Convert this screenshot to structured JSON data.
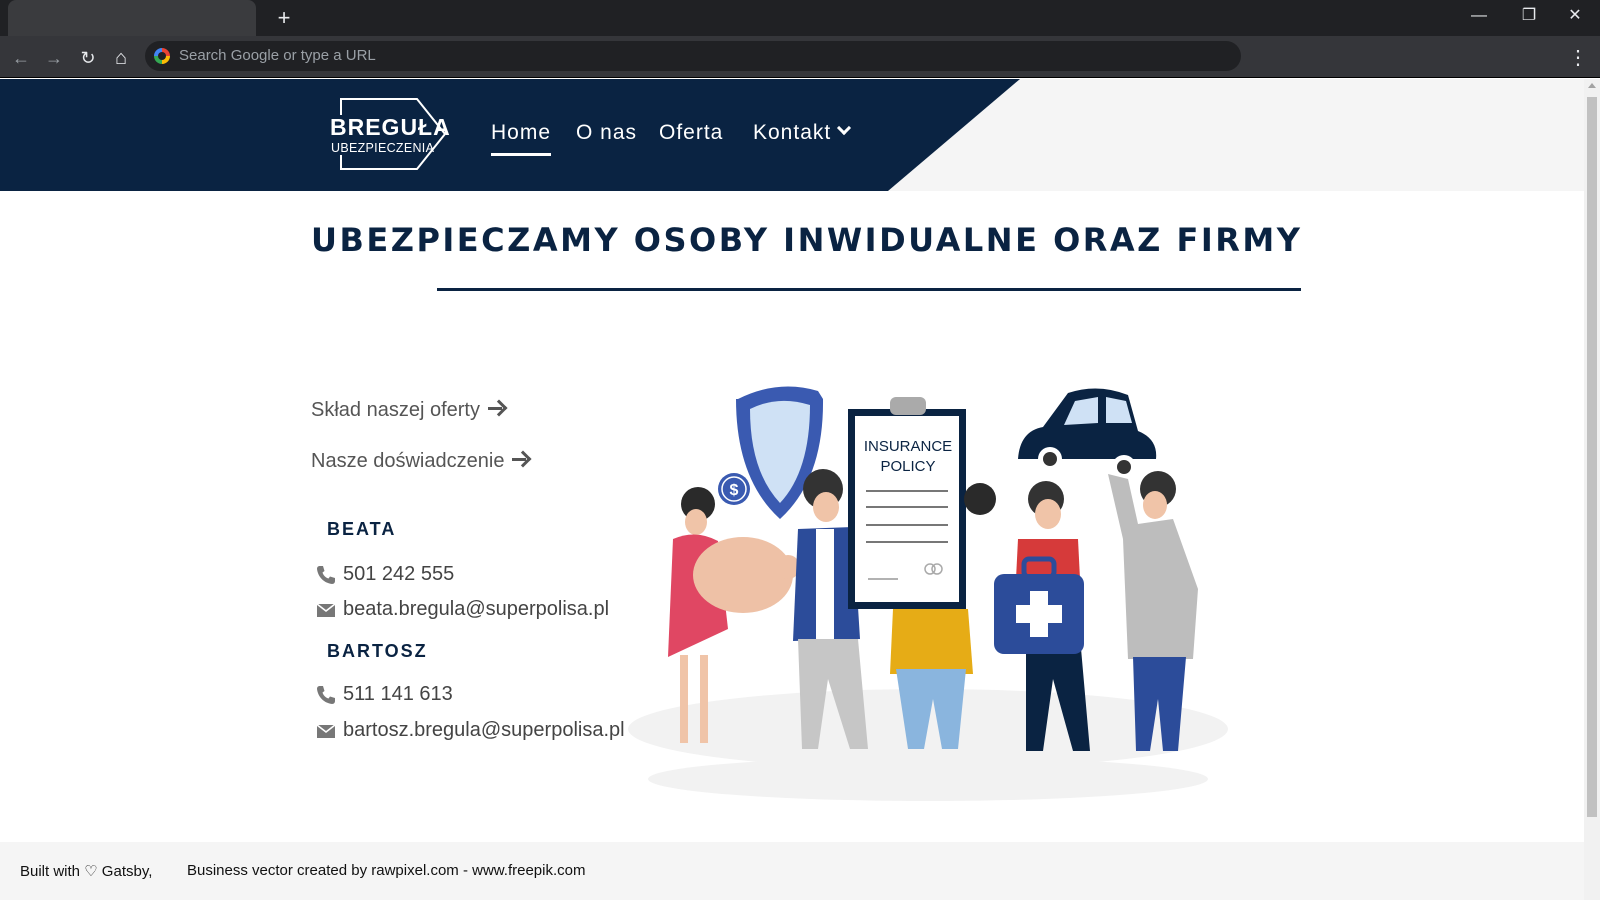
{
  "browser": {
    "new_tab_label": "+",
    "address_placeholder": "Search Google or type a URL",
    "buttons": {
      "back": "←",
      "forward": "→",
      "reload": "↻",
      "home": "⌂",
      "menu": "⋮",
      "minimize": "—",
      "restore": "❐",
      "close": "✕"
    }
  },
  "header": {
    "logo_line1": "BREGUŁA",
    "logo_line2": "UBEZPIECZENIA",
    "nav": [
      {
        "label": "Home"
      },
      {
        "label": "O nas"
      },
      {
        "label": "Oferta"
      },
      {
        "label": "Kontakt"
      }
    ]
  },
  "main": {
    "headline": "UBEZPIECZAMY OSOBY INWIDUALNE ORAZ FIRMY",
    "links": [
      {
        "label": "Skład naszej oferty"
      },
      {
        "label": "Nasze doświadczenie"
      }
    ],
    "contacts": [
      {
        "name": "BEATA",
        "phone": "501 242 555",
        "email": "beata.bregula@superpolisa.pl"
      },
      {
        "name": "BARTOSZ",
        "phone": "511 141 613",
        "email": "bartosz.bregula@superpolisa.pl"
      }
    ],
    "illustration": {
      "policy_text_line1": "INSURANCE",
      "policy_text_line2": "POLICY",
      "coin_symbol": "$"
    }
  },
  "footer": {
    "built_with": "Built with ♡ Gatsby,",
    "credit": "Business vector created by rawpixel.com - www.freepik.com"
  },
  "colors": {
    "navy": "#0a2342",
    "chrome_dark": "#202124",
    "chrome_toolbar": "#35363a",
    "footer_bg": "#f5f5f5"
  }
}
